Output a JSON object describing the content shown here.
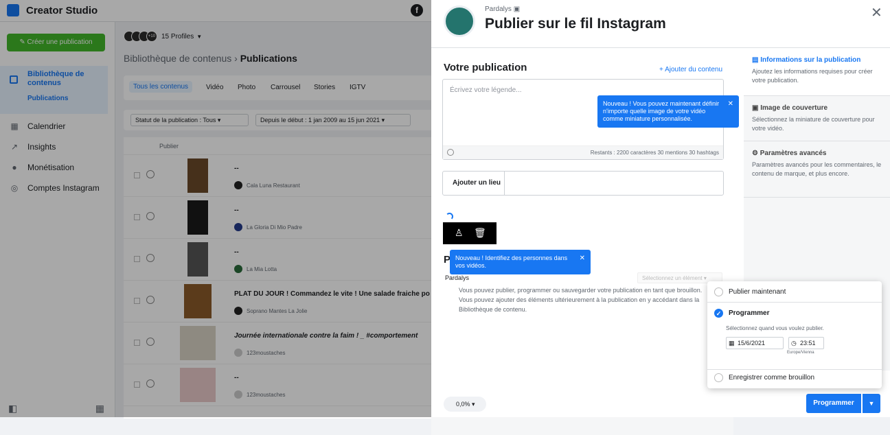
{
  "app": {
    "title": "Creator Studio"
  },
  "sidebar": {
    "create_label": "Créer une publication",
    "library_label": "Bibliothèque de contenus",
    "library_sub": "Publications",
    "items": [
      {
        "label": "Calendrier",
        "icon": "calendar-icon"
      },
      {
        "label": "Insights",
        "icon": "insights-icon"
      },
      {
        "label": "Monétisation",
        "icon": "monetization-icon"
      },
      {
        "label": "Comptes Instagram",
        "icon": "instagram-accounts-icon"
      }
    ]
  },
  "content": {
    "profiles_label": "15 Profiles",
    "profiles_badge": "+10",
    "breadcrumb_parent": "Bibliothèque de contenus",
    "breadcrumb_current": "Publications",
    "tabs": [
      "Tous les contenus",
      "Vidéo",
      "Photo",
      "Carrousel",
      "Stories",
      "IGTV"
    ],
    "filter_status": "Statut de la publication : Tous",
    "filter_date": "Depuis le début : 1 jan 2009 au 15 jun 2021",
    "table_header": "Publier",
    "rows": [
      {
        "title": "--",
        "account": "Cala Luna Restaurant"
      },
      {
        "title": "--",
        "account": "La Gloria Di Mio Padre"
      },
      {
        "title": "--",
        "account": "La Mia Lotta"
      },
      {
        "title": "PLAT DU JOUR ! Commandez le vite ! Une salade fraiche po",
        "account": "Soprano Mantes La Jolie"
      },
      {
        "title": "Journée internationale contre la faim ! _ #comportement",
        "account": "123moustaches"
      },
      {
        "title": "--",
        "account": "123moustaches"
      }
    ]
  },
  "panel": {
    "account": "Pardalys",
    "title": "Publier sur le fil Instagram",
    "section_title": "Votre publication",
    "add_content": "+ Ajouter du contenu",
    "caption_placeholder": "Écrivez votre légende...",
    "remaining": "Restants : 2200 caractères 30 mentions 30 hashtags",
    "add_location": "Ajouter un lieu",
    "tip_thumbnail": "Nouveau ! Vous pouvez maintenant définir n'importe quelle image de votre vidéo comme miniature personnalisée.",
    "tip_tag": "Nouveau ! Identifiez des personnes dans vos vidéos.",
    "section_p": "P",
    "pardalys_row": "Pardalys",
    "select_element": "Sélectionnez un élément",
    "info": "Vous pouvez publier, programmer ou sauvegarder votre publication en tant que brouillon. Vous pouvez ajouter des éléments ultérieurement à la publication en y accédant dans la Bibliothèque de contenu.",
    "zoom": "0,0%",
    "schedule_button": "Programmer",
    "right_cards": [
      {
        "title": "Informations sur la publication",
        "desc": "Ajoutez les informations requises pour créer votre publication."
      },
      {
        "title": "Image de couverture",
        "desc": "Sélectionnez la miniature de couverture pour votre vidéo."
      },
      {
        "title": "Paramètres avancés",
        "desc": "Paramètres avancés pour les commentaires, le contenu de marque, et plus encore."
      }
    ]
  },
  "popup": {
    "publish_now": "Publier maintenant",
    "schedule": "Programmer",
    "schedule_hint": "Sélectionnez quand vous voulez publier.",
    "date": "15/6/2021",
    "time": "23:51",
    "timezone": "Europe/Vienna",
    "draft": "Enregistrer comme brouillon"
  },
  "colors": {
    "accent": "#1877f2",
    "create": "#42b72a"
  }
}
